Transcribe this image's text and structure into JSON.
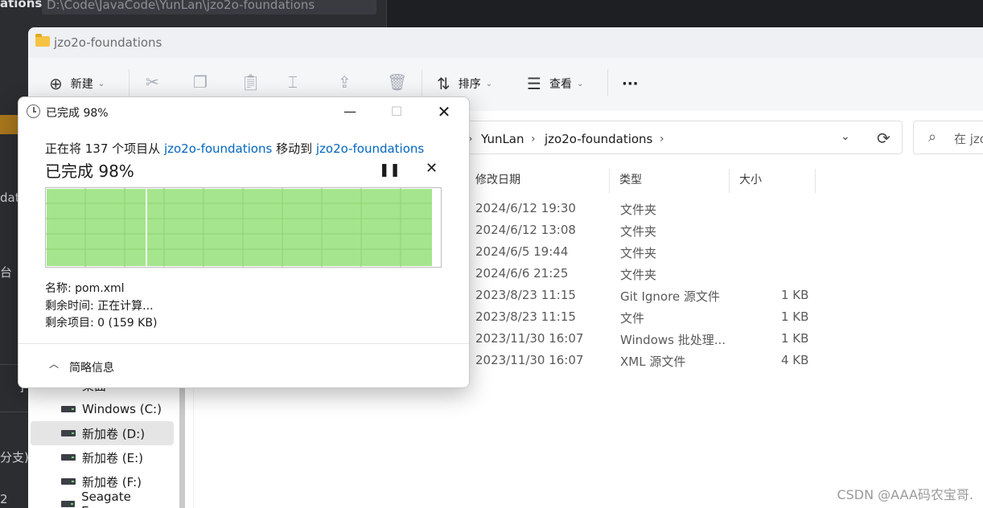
{
  "ide": {
    "project_name": "ations",
    "project_path": "D:\\Code\\JavaCode\\YunLan\\jzo2o-foundations",
    "fragments": [
      "dat",
      "台",
      "]",
      "分支)",
      "2"
    ]
  },
  "explorer": {
    "title": "jzo2o-foundations",
    "toolbar": {
      "new_label": "新建",
      "sort_label": "排序",
      "view_label": "查看",
      "more_label": "···"
    },
    "breadcrumb": [
      "YunLan",
      "jzo2o-foundations"
    ],
    "search_placeholder": "在 jzo",
    "nav": [
      {
        "label": "桌面",
        "selected": false
      },
      {
        "label": "Windows (C:)",
        "selected": false
      },
      {
        "label": "新加卷 (D:)",
        "selected": true
      },
      {
        "label": "新加卷 (E:)",
        "selected": false
      },
      {
        "label": "新加卷 (F:)",
        "selected": false
      },
      {
        "label": "Seagate Expans",
        "selected": false
      }
    ],
    "columns": {
      "modified": "修改日期",
      "type": "类型",
      "size": "大小"
    },
    "rows": [
      {
        "modified": "2024/6/12 19:30",
        "type": "文件夹",
        "size": ""
      },
      {
        "modified": "2024/6/12 13:08",
        "type": "文件夹",
        "size": ""
      },
      {
        "modified": "2024/6/5 19:44",
        "type": "文件夹",
        "size": ""
      },
      {
        "modified": "2024/6/6 21:25",
        "type": "文件夹",
        "size": ""
      },
      {
        "modified": "2023/8/23 11:15",
        "type": "Git Ignore 源文件",
        "size": "1 KB"
      },
      {
        "modified": "2023/8/23 11:15",
        "type": "文件",
        "size": "1 KB"
      },
      {
        "modified": "2023/11/30 16:07",
        "type": "Windows 批处理...",
        "size": "1 KB"
      },
      {
        "modified": "2023/11/30 16:07",
        "type": "XML 源文件",
        "size": "4 KB"
      }
    ],
    "watermark": "CSDN @AAA码农宝哥."
  },
  "dialog": {
    "title": "已完成 98%",
    "message_prefix": "正在将 137 个项目从 ",
    "source": "jzo2o-foundations",
    "message_middle": " 移动到 ",
    "destination": "jzo2o-foundations",
    "heading": "已完成 98%",
    "progress": 0.98,
    "progress_color": "#a4e58d",
    "name_line": "名称: pom.xml",
    "time_line": "剩余时间: 正在计算...",
    "items_line": "剩余项目: 0 (159 KB)",
    "fewer_details": "简略信息"
  }
}
